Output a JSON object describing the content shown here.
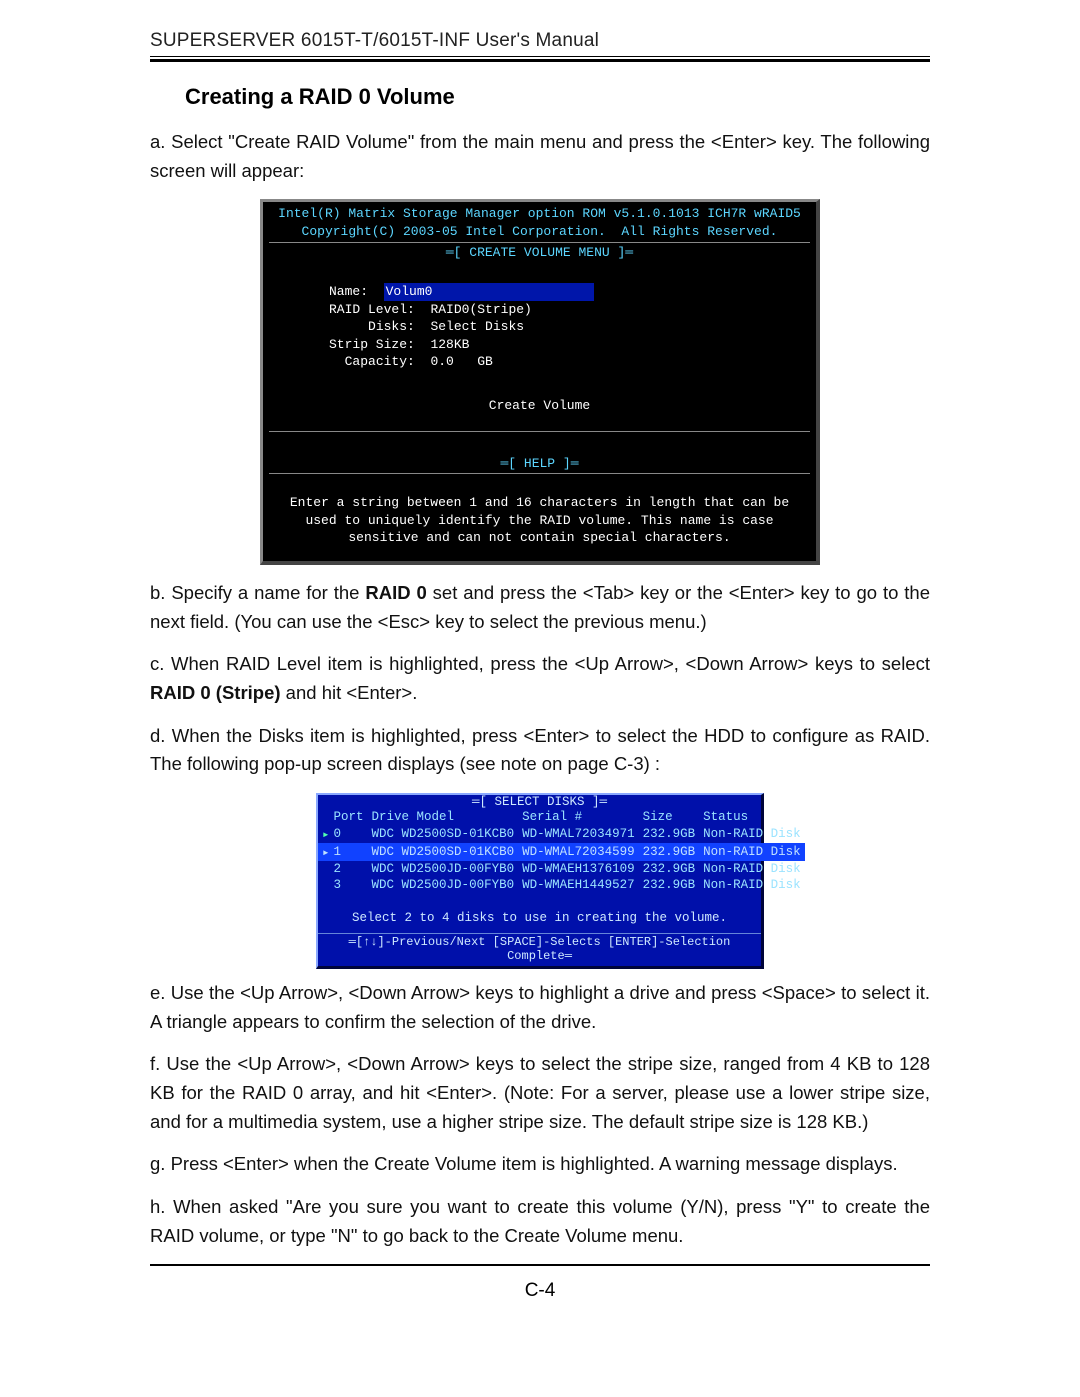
{
  "header": "SUPERSERVER 6015T-T/6015T-INF User's Manual",
  "section_title": "Creating a RAID 0 Volume",
  "intro_a": "a. Select \"Create RAID Volume\" from the main menu and press the <Enter> key. The following screen will appear:",
  "bios1": {
    "title_l1": "Intel(R) Matrix Storage Manager option ROM v5.1.0.1013 ICH7R wRAID5",
    "title_l2": "Copyright(C) 2003-05 Intel Corporation.  All Rights Reserved.",
    "frame_top": "═[ CREATE VOLUME MENU ]═",
    "name_label": "Name:",
    "name_val": "Volum0",
    "raid_label": "RAID Level:",
    "raid_val": "RAID0(Stripe)",
    "disks_label": "Disks:",
    "disks_val": "Select Disks",
    "strip_label": "Strip Size:",
    "strip_val": "128KB",
    "cap_label": "Capacity:",
    "cap_val": "0.0   GB",
    "create_label": "Create Volume",
    "frame_help": "═[ HELP ]═",
    "help_text": "Enter a string between 1 and 16 characters in length that can be used to uniquely identify the RAID volume. This name is case sensitive and can not contain special characters."
  },
  "para_b_pre": "b. Specify a name for the ",
  "para_b_bold": "RAID 0",
  "para_b_post": " set and press the <Tab> key or the <Enter> key to go to the next field. (You can use the <Esc> key to select the previous menu.)",
  "para_c_pre": "c. When RAID Level item is highlighted, press the <Up Arrow>, <Down Arrow> keys to select ",
  "para_c_bold": "RAID 0 (Stripe)",
  "para_c_post": " and hit <Enter>.",
  "para_d": "d. When the Disks item is highlighted, press <Enter> to select the HDD to configure as RAID.  The following pop-up screen displays (see note on page C-3) :",
  "popup": {
    "frame_label": "═[ SELECT DISKS ]═",
    "columns": {
      "port": "Port",
      "drive": "Drive Model",
      "serial": "Serial #",
      "size": "Size",
      "status": "Status"
    },
    "rows": [
      {
        "sel": true,
        "port": "0",
        "drive": "WDC WD2500SD-01KCB0",
        "serial": "WD-WMAL72034971",
        "size": "232.9GB",
        "status": "Non-RAID Disk",
        "hl": false
      },
      {
        "sel": true,
        "port": "1",
        "drive": "WDC WD2500SD-01KCB0",
        "serial": "WD-WMAL72034599",
        "size": "232.9GB",
        "status": "Non-RAID Disk",
        "hl": true
      },
      {
        "sel": false,
        "port": "2",
        "drive": "WDC WD2500JD-00FYB0",
        "serial": "WD-WMAEH1376109",
        "size": "232.9GB",
        "status": "Non-RAID Disk",
        "hl": false
      },
      {
        "sel": false,
        "port": "3",
        "drive": "WDC WD2500JD-00FYB0",
        "serial": "WD-WMAEH1449527",
        "size": "232.9GB",
        "status": "Non-RAID Disk",
        "hl": false
      }
    ],
    "instr": "Select 2 to 4 disks to use in creating the volume.",
    "footer": "═[↑↓]-Previous/Next  [SPACE]-Selects  [ENTER]-Selection Complete═"
  },
  "para_e": "e. Use  the <Up Arrow>, <Down Arrow> keys to highlight a drive and press <Space> to select it. A triangle appears to confirm the selection of the drive.",
  "para_f": "f. Use  the <Up Arrow>, <Down Arrow> keys to select the stripe size, ranged from 4 KB to 128 KB for the RAID 0 array, and hit <Enter>. (Note: For a server, please use a lower stripe size, and for a multimedia system, use a higher stripe size. The default stripe size is 128 KB.)",
  "para_g": "g. Press <Enter> when the Create Volume item is highlighted. A warning message displays.",
  "para_h": "h. When asked \"Are you sure you want to create this volume (Y/N), press \"Y\" to create the RAID volume, or type \"N\" to go back to the Create Volume menu.",
  "page_num": "C-4"
}
